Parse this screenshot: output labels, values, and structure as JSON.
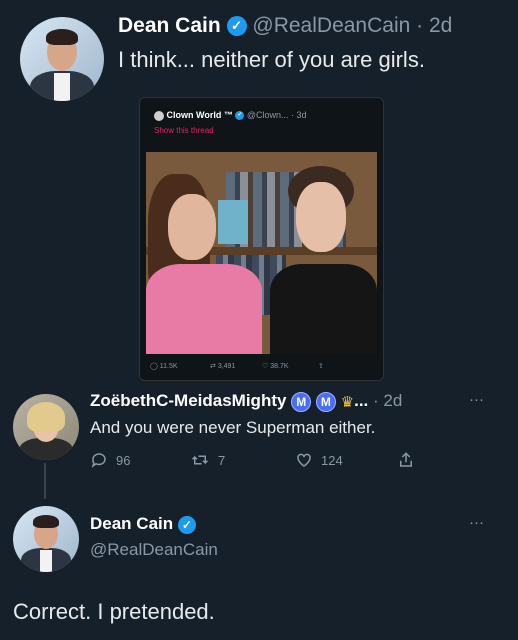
{
  "tweet1": {
    "author_name": "Dean Cain",
    "handle": "@RealDeanCain",
    "time": "· 2d",
    "text": "I think... neither of you are girls."
  },
  "embed": {
    "author_name": "Clown World ™",
    "handle_time": "@Clown... · 3d",
    "show_thread": "Show this thread",
    "stats": {
      "replies": "11.5K",
      "retweets": "3,491",
      "likes": "38.7K"
    }
  },
  "tweet2": {
    "author_name": "ZoëbethC-MeidasMighty",
    "badge": "M",
    "truncation": "...",
    "time": "· 2d",
    "more": "···",
    "text": "And you were never Superman either.",
    "stats": {
      "replies": "96",
      "retweets": "7",
      "likes": "124"
    }
  },
  "tweet3": {
    "author_name": "Dean Cain",
    "handle": "@RealDeanCain",
    "more": "···",
    "text": "Correct. I pretended."
  },
  "colors": {
    "background": "#15202b",
    "verified": "#1d9bf0",
    "secondary_text": "#8b98a5",
    "show_thread": "#e0245e"
  },
  "icons": [
    "verified-icon",
    "reply-icon",
    "retweet-icon",
    "like-icon",
    "share-icon",
    "more-icon",
    "crown-icon"
  ]
}
